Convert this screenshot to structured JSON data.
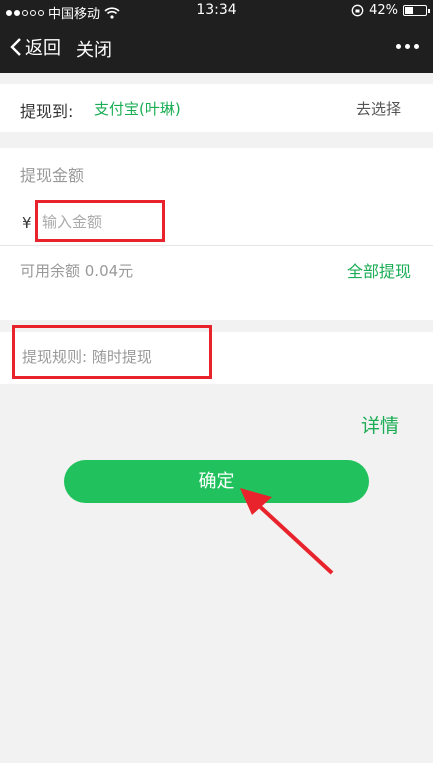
{
  "status_bar": {
    "carrier": "中国移动",
    "time": "13:34",
    "battery": "42%",
    "battery_level": 0.42
  },
  "nav": {
    "back_label": "返回",
    "close_label": "关闭"
  },
  "withdraw_to": {
    "label": "提现到:",
    "account": "支付宝(叶琳)",
    "choose": "去选择"
  },
  "amount": {
    "title": "提现金额",
    "currency_symbol": "¥",
    "placeholder": "输入金额",
    "balance": "可用余额 0.04元",
    "withdraw_all": "全部提现"
  },
  "rule": {
    "text": "提现规则: 随时提现"
  },
  "details_label": "详情",
  "confirm_label": "确定",
  "colors": {
    "accent": "#1aad55",
    "button": "#21c25e",
    "annotation": "#e8232b",
    "header": "#1f1f1f"
  }
}
